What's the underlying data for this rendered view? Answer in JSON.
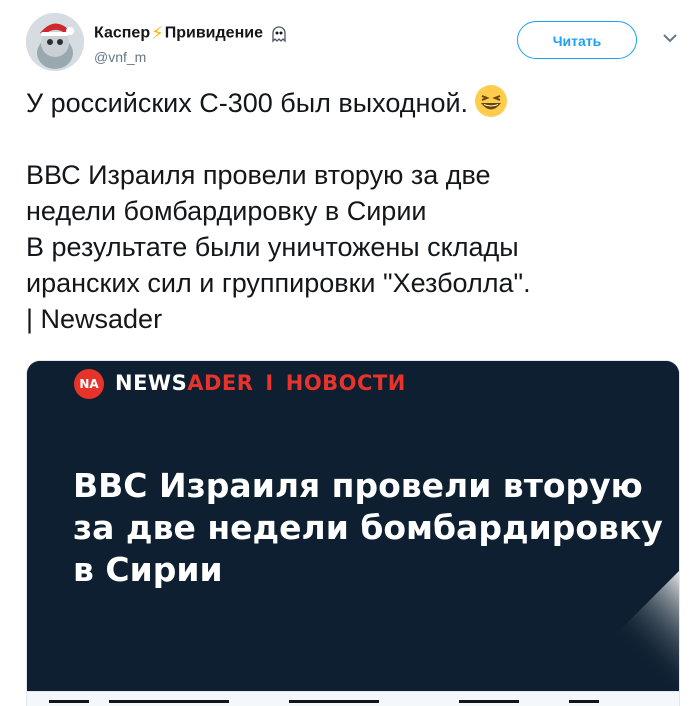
{
  "header": {
    "display_name_part1": "Каспер",
    "bolt_emoji": "⚡",
    "display_name_part2": "Привидение",
    "ghost_emoji": "👻",
    "handle": "@vnf_m",
    "follow_label": "Читать"
  },
  "tweet": {
    "line1": "У российских С-300 был выходной.",
    "body": "ВВС Израиля провели вторую за две\nнедели бомбардировку в Сирии\nВ результате были уничтожены склады\nиранских сил и группировки \"Хезболла\".\n | Newsader"
  },
  "card": {
    "logo_text": "NA",
    "brand_news": "NEWS",
    "brand_ader": "ADER",
    "brand_sep": "I",
    "brand_section": "НОВОСТИ",
    "headline": "ВВС Израиля провели вторую за две недели бомбардировку в Сирии"
  },
  "colors": {
    "accent": "#1da1f2",
    "card_bg": "#0d1f30",
    "brand_red": "#e8332a"
  }
}
